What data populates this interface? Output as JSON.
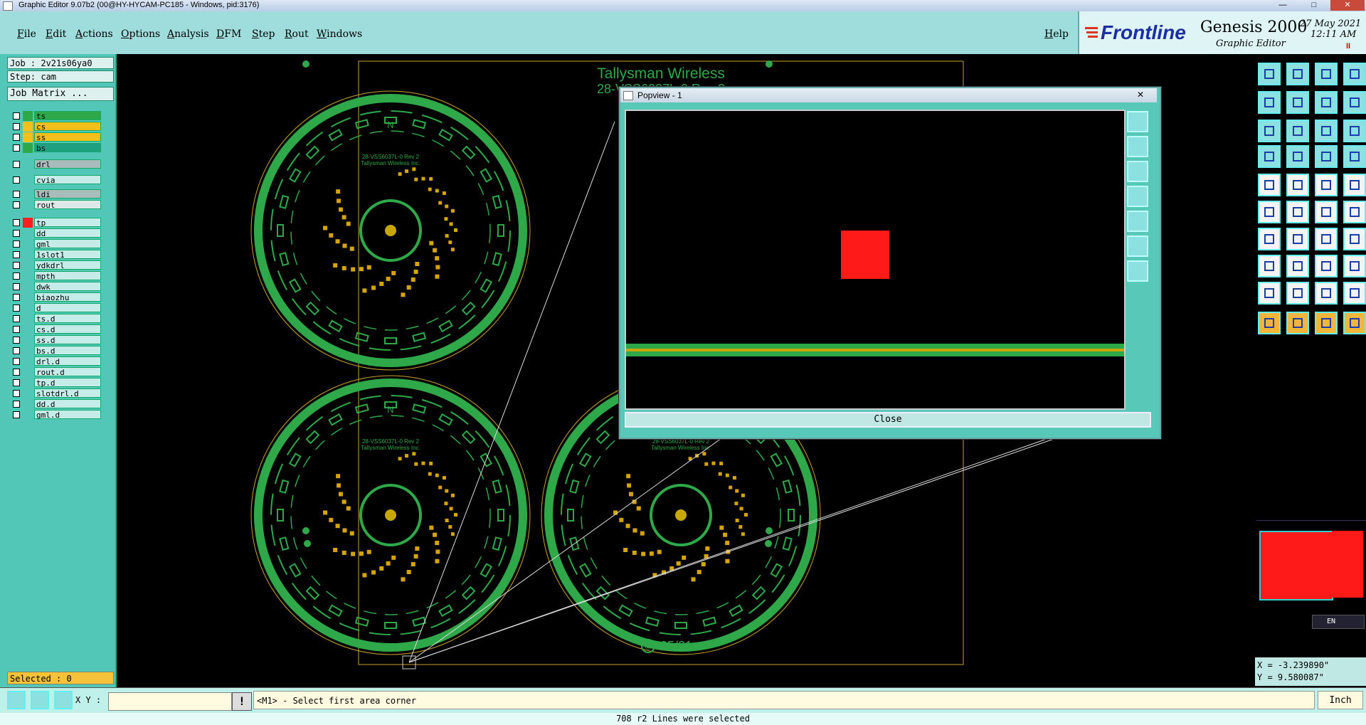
{
  "window": {
    "title": "Graphic Editor 9.07b2 (00@HY-HYCAM-PC185 - Windows, pid:3176)",
    "min": "—",
    "max": "□",
    "close": "✕"
  },
  "menu": {
    "items": [
      "File",
      "Edit",
      "Actions",
      "Options",
      "Analysis",
      "DFM",
      "Step",
      "Rout",
      "Windows"
    ],
    "help": "Help"
  },
  "logo": {
    "brand": "Frontline",
    "product": "Genesis 2000",
    "subtitle": "Graphic Editor",
    "date": "27 May 2021",
    "time": "12:11 AM",
    "marker": "II"
  },
  "job": {
    "job": "Job : 2v21s06ya0",
    "step": "Step: cam",
    "matrix": "Job Matrix ..."
  },
  "layers": [
    {
      "name": "ts",
      "color": "#2fa84a",
      "namebg": "#2fa84a"
    },
    {
      "name": "cs",
      "color": "#f2c018",
      "namebg": "#f2c018"
    },
    {
      "name": "ss",
      "color": "#f2c018",
      "namebg": "#f2c018"
    },
    {
      "name": "bs",
      "color": "#2fa84a",
      "namebg": "#1ea080"
    },
    {
      "name": "drl",
      "color": "",
      "namebg": "#a9bbbb"
    },
    {
      "name": "cvia",
      "color": "",
      "namebg": "#c6ecea"
    },
    {
      "name": "ldi",
      "color": "",
      "namebg": "#a9bbbb"
    },
    {
      "name": "rout",
      "color": "",
      "namebg": "#dfe8e8"
    },
    {
      "name": "tp",
      "color": "#ff1e1e",
      "namebg": "#c6ecea"
    },
    {
      "name": "dd",
      "color": "",
      "namebg": "#c6ecea"
    },
    {
      "name": "gml",
      "color": "",
      "namebg": "#c6ecea"
    },
    {
      "name": "1slot1",
      "color": "",
      "namebg": "#c6ecea"
    },
    {
      "name": "ydkdrl",
      "color": "",
      "namebg": "#c6ecea"
    },
    {
      "name": "mpth",
      "color": "",
      "namebg": "#c6ecea"
    },
    {
      "name": "dwk",
      "color": "",
      "namebg": "#c6ecea"
    },
    {
      "name": "biaozhu",
      "color": "",
      "namebg": "#c6ecea"
    },
    {
      "name": "d",
      "color": "",
      "namebg": "#c6ecea"
    },
    {
      "name": "ts.d",
      "color": "",
      "namebg": "#c6ecea"
    },
    {
      "name": "cs.d",
      "color": "",
      "namebg": "#c6ecea"
    },
    {
      "name": "ss.d",
      "color": "",
      "namebg": "#c6ecea"
    },
    {
      "name": "bs.d",
      "color": "",
      "namebg": "#c6ecea"
    },
    {
      "name": "drl.d",
      "color": "",
      "namebg": "#c6ecea"
    },
    {
      "name": "rout.d",
      "color": "",
      "namebg": "#c6ecea"
    },
    {
      "name": "tp.d",
      "color": "",
      "namebg": "#c6ecea"
    },
    {
      "name": "slotdrl.d",
      "color": "",
      "namebg": "#c6ecea"
    },
    {
      "name": "dd.d",
      "color": "",
      "namebg": "#c6ecea"
    },
    {
      "name": "gml.d",
      "color": "",
      "namebg": "#c6ecea"
    }
  ],
  "selected": "Selected : 0",
  "board": {
    "title": "Tallysman Wireless",
    "subtitle": "28-VSS6037L-0 Rev 2",
    "inner1": "28-VSS6037L-0 Rev 2",
    "inner2": "Tallysman Wireless Inc.",
    "north": "N",
    "date": "05/21",
    "copyright": "©"
  },
  "popup": {
    "title": "Popview - 1",
    "close_x": "✕",
    "close_button": "Close"
  },
  "coords": {
    "x": "X = -3.239890\"",
    "y": "Y = 9.580087\""
  },
  "status": {
    "xy_label": "X Y :",
    "xy_value": "",
    "prompt": "<M1> - Select first area corner",
    "units": "Inch"
  },
  "bottom": "708 r2 Lines were selected",
  "lang": "EN",
  "colors": {
    "accent": "#58c8b8",
    "board_green": "#2fa84a",
    "pad_yellow": "#d6a400",
    "highlight": "#ff0000"
  }
}
